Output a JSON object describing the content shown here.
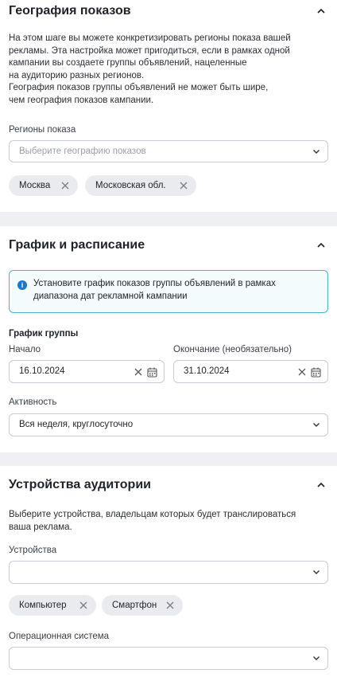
{
  "geo": {
    "title": "География показов",
    "description": "На этом шаге вы можете конкретизировать регионы показа вашей\nрекламы. Эта настройка может пригодиться, если в рамках одной\nкампании вы создаете группы объявлений, нацеленные\nна аудиторию разных регионов.\nГеография показов группы объявлений не может быть шире,\nчем география показов кампании.",
    "regions_label": "Регионы показа",
    "regions_placeholder": "Выберите географию показов",
    "chips": [
      "Москва",
      "Московская обл."
    ]
  },
  "schedule": {
    "title": "График и расписание",
    "info": "Установите график показов группы объявлений в рамках\nдиапазона дат рекламной кампании",
    "group_label": "График группы",
    "start_label": "Начало",
    "start_value": "16.10.2024",
    "end_label": "Окончание (необязательно)",
    "end_value": "31.10.2024",
    "activity_label": "Активность",
    "activity_value": "Вся неделя, круглосуточно"
  },
  "devices": {
    "title": "Устройства аудитории",
    "description": "Выберите устройства, владельцам которых будет транслироваться\nваша реклама.",
    "devices_label": "Устройства",
    "devices_value": "",
    "chips": [
      "Компьютер",
      "Смартфон"
    ],
    "os_label": "Операционная система",
    "os_value": ""
  },
  "icons": {
    "collapse": "chevron-up-icon",
    "dropdown": "chevron-down-icon",
    "remove": "close-icon",
    "clear": "close-icon",
    "calendar": "calendar-icon",
    "info": "info-icon"
  }
}
